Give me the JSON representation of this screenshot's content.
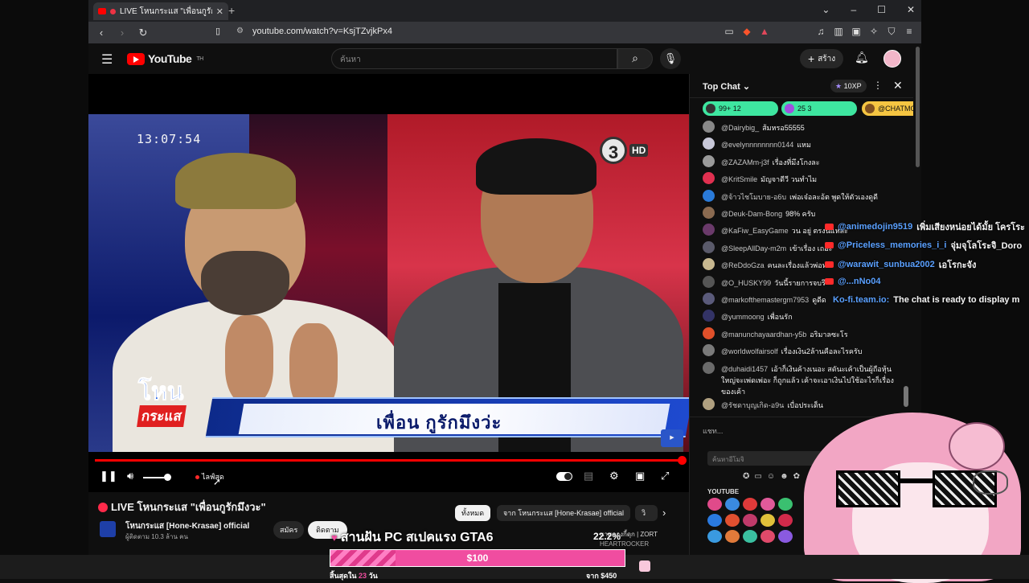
{
  "browser": {
    "tab_title": "LIVE โหนกระแส \"เพื่อนกูรักมึงวะ\"",
    "url": "youtube.com/watch?v=KsjTZvjkPx4"
  },
  "header": {
    "logo_text": "YouTube",
    "logo_region": "TH",
    "search_placeholder": "ค้นหา",
    "create_label": "สร้าง"
  },
  "video": {
    "clock": "13:07:54",
    "channel_logo_number": "3",
    "channel_logo_hd": "HD",
    "show_logo_line1": "โหน",
    "show_logo_line2": "กระแส",
    "lower_third": "เพื่อน กูรักมึงว่ะ",
    "progress": 1.0,
    "volume": 0.8,
    "live_label": "ไลฟ์สด"
  },
  "below": {
    "title": "LIVE โหนกระแส \"เพื่อนกูรักมึงวะ\"",
    "channel_name": "โหนกระแส [Hone-Krasae] official",
    "subscribers": "ผู้ติดตาม 10.3 ล้าน คน",
    "join_label": "สมัคร",
    "subscribe_label": "ติดตาม",
    "chips": [
      "ทั้งหมด",
      "จาก โหนกระแส [Hone-Krasae] official",
      "วิ"
    ]
  },
  "chat": {
    "mode": "Top Chat",
    "xp": "10XP",
    "pins": [
      {
        "text": "99+  12",
        "color": "#3ee6a0"
      },
      {
        "text": "25  3",
        "color": "#3ee6a0"
      },
      {
        "text": "@CHATMO",
        "color": "#f5c542"
      }
    ],
    "messages": [
      {
        "author": "@Dairybig_",
        "text": "ส้มหรอ55555",
        "color": "#888888"
      },
      {
        "author": "@evelynnnnnnnn0144",
        "text": "แหม",
        "color": "#c8c8d8"
      },
      {
        "author": "@ZAZAMm-j3f",
        "text": "เรื่องที่มึงโกงละ",
        "color": "#9a9a9a"
      },
      {
        "author": "@KritSmile",
        "text": "มัญจาดีวี วนทำไม",
        "color": "#e03050"
      },
      {
        "author": "@จ้าวไชโมบาย-อ6บ",
        "text": "เพ่อเจ๋อละอ้ต พูดให้ตัวเองดูดี",
        "color": "#2a7ad8"
      },
      {
        "author": "@Deuk-Dam-Bong",
        "text": "98% ครับ",
        "color": "#8a6a50"
      },
      {
        "author": "@KaFiw_EasyGame",
        "text": "วน อยู่ ตรงนี้แหละ",
        "color": "#6a3a6a"
      },
      {
        "author": "@SleepAllDay-m2m",
        "text": "เข้าเรื่อง เถอะ",
        "color": "#5a5a6a"
      },
      {
        "author": "@ReDdoGza",
        "text": "คนละเรื่องแล้วพ่อห",
        "color": "#c8b890"
      },
      {
        "author": "@O_HUSKY99",
        "text": "วันนี้รายการจบรึ",
        "color": "#555555"
      },
      {
        "author": "@markofthemastergm7953",
        "text": "ดูดีด",
        "color": "#5a5a7a"
      },
      {
        "author": "@yummoong",
        "text": "เพื่อนรัก",
        "color": "#333366"
      },
      {
        "author": "@manunchayaardhan-y5b",
        "text": "อริมาลซะโร",
        "color": "#e0502a"
      },
      {
        "author": "@worldwolfairsolf",
        "text": "เรื่องเงิน2ล้านคือละไรครับ",
        "color": "#7a7a7a"
      },
      {
        "author": "@duhaidi1457",
        "text": "เอ้าก็เงินค้างเนอะ สดันะเค้าเป็นผู้ถือหุ้นใหญ่จะเพ่ดเพ่อะ ก็ถูกแล้ว เค้าจะเอาเงินไปใช้อะไรก็เรื่องของเค้า",
        "color": "#6a6a6a"
      },
      {
        "author": "@รัชดาบุญเกิด-อ9น",
        "text": "เบื่อประเด็น",
        "color": "#b0a080"
      }
    ],
    "input_placeholder": "แชท...",
    "emoji_search_placeholder": "ค้นหาอีโมจิ",
    "emoji_section": "YOUTUBE"
  },
  "overlay_chat": [
    {
      "user": "@animedojin9519",
      "text": "เพิ่มเสียงหน่อยได้มั้ย โครโระ"
    },
    {
      "user": "@Priceless_memories_i_i",
      "text": "จุ่มจุโลโระจิ_Doro"
    },
    {
      "user": "@warawit_sunbua2002",
      "text": "เอโรกะจัง"
    },
    {
      "user": "@...nNo04",
      "text": ""
    },
    {
      "user": "Ko-fi.team.io:",
      "text": "The chat is ready to display m"
    }
  ],
  "goal_banner": {
    "title": "สานฝัน PC สเปคแรง GTA6",
    "percent": "22.2%",
    "amount": "$100",
    "remaining_prefix": "สิ้นสุดใน",
    "remaining_value": "23",
    "remaining_unit": "วัน",
    "target": "จาก $450",
    "side_line1": "นามควงกี้ดุก | ZORT",
    "side_line2": "HEARTROCKER"
  }
}
